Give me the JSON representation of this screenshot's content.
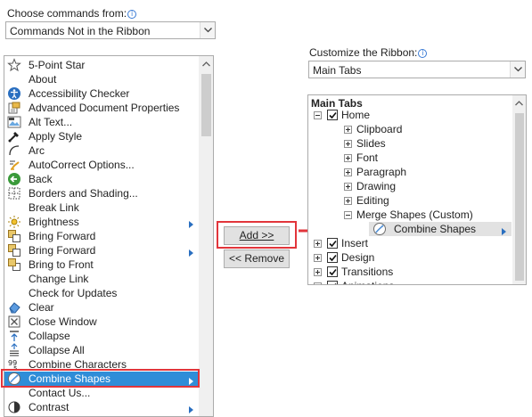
{
  "left": {
    "choose_label": "Choose commands from:",
    "choose_value": "Commands Not in the Ribbon",
    "commands": [
      {
        "label": "5-Point Star",
        "icon": "star-icon"
      },
      {
        "label": "About",
        "icon": ""
      },
      {
        "label": "Accessibility Checker",
        "icon": "accessibility-icon"
      },
      {
        "label": "Advanced Document Properties",
        "icon": "document-properties-icon"
      },
      {
        "label": "Alt Text...",
        "icon": "alt-text-icon"
      },
      {
        "label": "Apply Style",
        "icon": "apply-style-icon"
      },
      {
        "label": "Arc",
        "icon": "arc-icon"
      },
      {
        "label": "AutoCorrect Options...",
        "icon": "autocorrect-icon"
      },
      {
        "label": "Back",
        "icon": "back-icon"
      },
      {
        "label": "Borders and Shading...",
        "icon": "borders-icon"
      },
      {
        "label": "Break Link",
        "icon": ""
      },
      {
        "label": "Brightness",
        "icon": "brightness-icon",
        "submenu": true
      },
      {
        "label": "Bring Forward",
        "icon": "bring-forward-icon"
      },
      {
        "label": "Bring Forward",
        "icon": "bring-forward-icon",
        "submenu": true
      },
      {
        "label": "Bring to Front",
        "icon": "bring-to-front-icon"
      },
      {
        "label": "Change Link",
        "icon": ""
      },
      {
        "label": "Check for Updates",
        "icon": ""
      },
      {
        "label": "Clear",
        "icon": "clear-icon"
      },
      {
        "label": "Close Window",
        "icon": "close-window-icon"
      },
      {
        "label": "Collapse",
        "icon": "collapse-icon"
      },
      {
        "label": "Collapse All",
        "icon": "collapse-all-icon"
      },
      {
        "label": "Combine Characters",
        "icon": "combine-characters-icon"
      },
      {
        "label": "Combine Shapes",
        "icon": "combine-shapes-icon",
        "submenu": true,
        "selected": true
      },
      {
        "label": "Contact Us...",
        "icon": ""
      },
      {
        "label": "Contrast",
        "icon": "contrast-icon",
        "submenu": true
      }
    ]
  },
  "middle": {
    "add_label": "Add >>",
    "remove_label": "<< Remove"
  },
  "right": {
    "customize_label": "Customize the Ribbon:",
    "customize_value": "Main Tabs",
    "tree_header": "Main Tabs",
    "tree": [
      {
        "label": "Home",
        "level": 0,
        "expander": "minus",
        "checkbox": true
      },
      {
        "label": "Clipboard",
        "level": 1,
        "expander": "plus"
      },
      {
        "label": "Slides",
        "level": 1,
        "expander": "plus"
      },
      {
        "label": "Font",
        "level": 1,
        "expander": "plus"
      },
      {
        "label": "Paragraph",
        "level": 1,
        "expander": "plus"
      },
      {
        "label": "Drawing",
        "level": 1,
        "expander": "plus"
      },
      {
        "label": "Editing",
        "level": 1,
        "expander": "plus"
      },
      {
        "label": "Merge Shapes (Custom)",
        "level": 1,
        "expander": "minus"
      },
      {
        "label": "Combine Shapes",
        "level": 2,
        "icon": "combine-shapes-icon",
        "submenu": true,
        "selected": true
      },
      {
        "label": "Insert",
        "level": 0,
        "expander": "plus",
        "checkbox": true
      },
      {
        "label": "Design",
        "level": 0,
        "expander": "plus",
        "checkbox": true
      },
      {
        "label": "Transitions",
        "level": 0,
        "expander": "plus",
        "checkbox": true
      },
      {
        "label": "Animations",
        "level": 0,
        "expander": "plus",
        "checkbox": true
      }
    ]
  },
  "colors": {
    "selection": "#2f8dd8",
    "highlight_box": "#e2353b",
    "arrow": "#e2353b"
  }
}
